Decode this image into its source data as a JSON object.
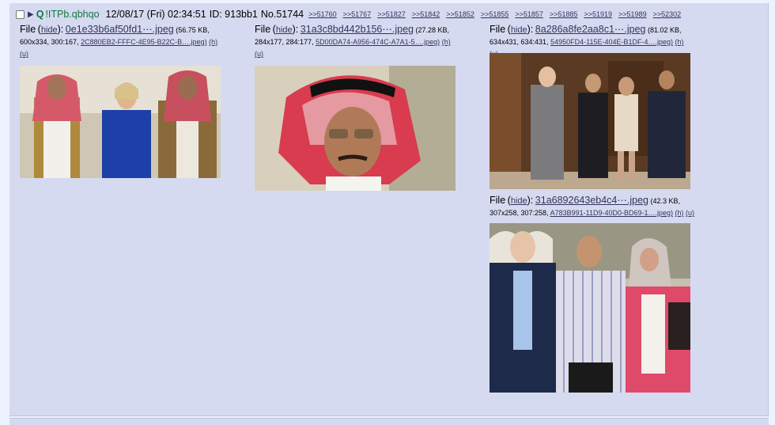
{
  "post": {
    "name": "Q",
    "tripcode": "!ITPb.qbhqo",
    "datetime": "12/08/17 (Fri) 02:34:51",
    "poster_id": "ID: 913bb1",
    "post_number": "No.51744",
    "backlinks": [
      ">>51760",
      ">>51767",
      ">>51827",
      ">>51842",
      ">>51852",
      ">>51855",
      ">>51857",
      ">>51885",
      ">>51919",
      ">>51989",
      ">>52302"
    ]
  },
  "files": [
    {
      "label": "File",
      "hide": "hide",
      "filename": "0e1e33b6af50fd1⋯.jpeg",
      "meta1": "(56.75 KB,",
      "meta2": "600x334, 300:167,",
      "hash": "2C880EB2-FFFC-4E95-B22C-B….jpeg)",
      "h": "(h)",
      "u": "(u)"
    },
    {
      "label": "File",
      "hide": "hide",
      "filename": "31a3c8bd442b156⋯.jpeg",
      "meta1": "(27.28 KB,",
      "meta2": "284x177, 284:177,",
      "hash": "5D00DA74-A956-474C-A7A1-5….jpeg)",
      "h": "(h)",
      "u": "(u)"
    },
    {
      "label": "File",
      "hide": "hide",
      "filename": "8a286a8fe2aa8c1⋯.jpeg",
      "meta1": "(81.02 KB,",
      "meta2": "634x431, 634:431,",
      "hash": "54950FD4-115E-404E-B1DF-4….jpeg)",
      "h": "(h)",
      "u": "(u)"
    },
    {
      "label": "File",
      "hide": "hide",
      "filename": "31a6892643eb4c4⋯.jpeg",
      "meta1": "(42.3 KB,",
      "meta2": "307x258, 307:258,",
      "hash": "A783B991-11D9-40D0-BD69-1….jpeg)",
      "h": "(h)",
      "u": "(u)"
    }
  ],
  "colors": {
    "post_bg": "#d6daf0",
    "page_bg": "#eef2ff",
    "name_green": "#117743",
    "link": "#34345c"
  }
}
